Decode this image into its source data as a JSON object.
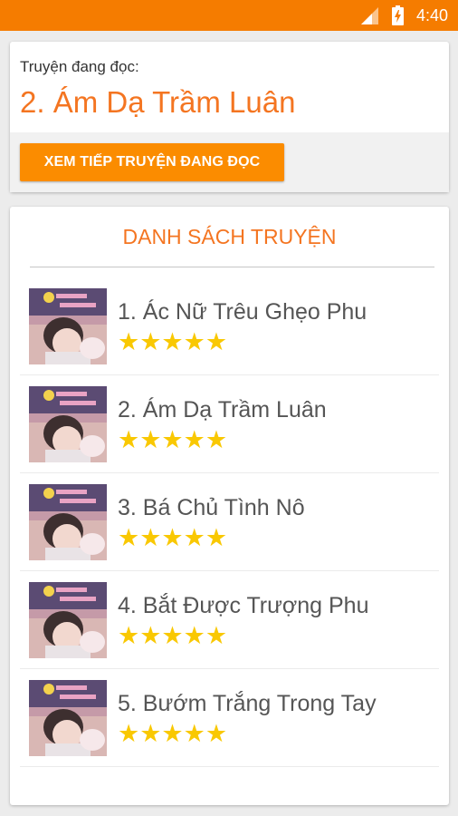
{
  "status_bar": {
    "time": "4:40"
  },
  "reading": {
    "caption": "Truyện đang đọc:",
    "title": "2. Ám Dạ Trầm Luân",
    "continue_button": "XEM TIẾP TRUYỆN ĐANG ĐỌC"
  },
  "list": {
    "heading": "DANH SÁCH TRUYỆN",
    "items": [
      {
        "title": "1. Ác Nữ Trêu Ghẹo Phu",
        "stars": "★★★★★"
      },
      {
        "title": "2. Ám Dạ Trầm Luân",
        "stars": "★★★★★"
      },
      {
        "title": "3. Bá Chủ Tình Nô",
        "stars": "★★★★★"
      },
      {
        "title": "4. Bắt Được Trượng Phu",
        "stars": "★★★★★"
      },
      {
        "title": "5. Bướm Trắng Trong Tay",
        "stars": "★★★★★"
      }
    ]
  },
  "colors": {
    "accent": "#f57c00",
    "title_orange": "#f47521",
    "star": "#f9c802"
  }
}
